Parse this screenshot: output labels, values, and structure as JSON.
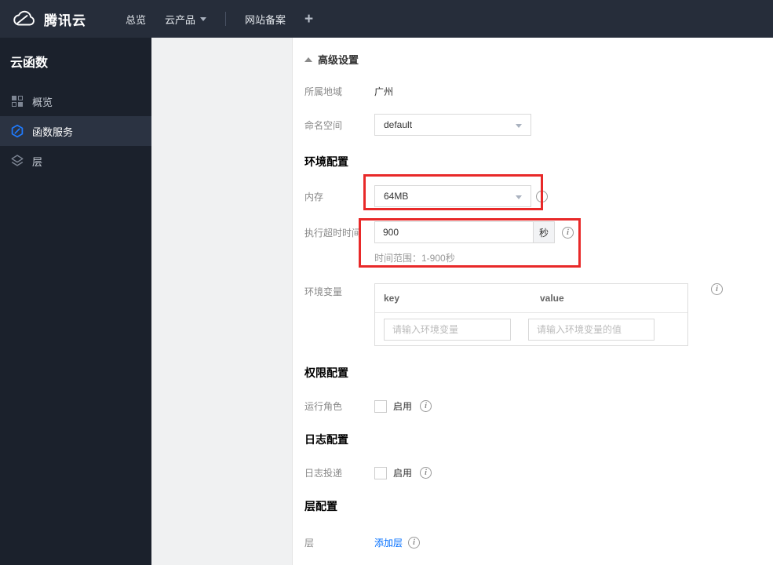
{
  "topbar": {
    "brand": "腾讯云",
    "nav": [
      {
        "label": "总览"
      },
      {
        "label": "云产品"
      },
      {
        "label": "网站备案"
      }
    ],
    "add_label": "+"
  },
  "sidebar": {
    "title": "云函数",
    "selected": "函数服务",
    "items": [
      {
        "label": "概览",
        "icon": "grid-icon"
      },
      {
        "label": "函数服务",
        "icon": "function-hexagon-icon"
      },
      {
        "label": "层",
        "icon": "layers-icon"
      }
    ]
  },
  "content": {
    "advanced_settings": {
      "label": "高级设置"
    },
    "region": {
      "label": "所属地域",
      "value": "广州"
    },
    "namespace": {
      "label": "命名空间",
      "value": "default"
    },
    "env_section_title": "环境配置",
    "memory": {
      "label": "内存",
      "value": "64MB"
    },
    "timeout": {
      "label": "执行超时时间",
      "value": "900",
      "unit": "秒",
      "hint": "时间范围：1-900秒"
    },
    "env_vars": {
      "label": "环境变量",
      "columns": [
        "key",
        "value"
      ],
      "key_placeholder": "请输入环境变量",
      "value_placeholder": "请输入环境变量的值"
    },
    "permission_section_title": "权限配置",
    "run_role": {
      "label": "运行角色",
      "checkbox_label": "启用"
    },
    "log_section_title": "日志配置",
    "log_delivery": {
      "label": "日志投递",
      "checkbox_label": "启用"
    },
    "layer_section_title": "层配置",
    "layer": {
      "label": "层",
      "add_link": "添加层"
    }
  },
  "colors": {
    "accent_blue": "#006eff",
    "highlight_red": "#e82929",
    "topbar_bg": "#262d3a",
    "sidebar_bg": "#1b212c"
  }
}
